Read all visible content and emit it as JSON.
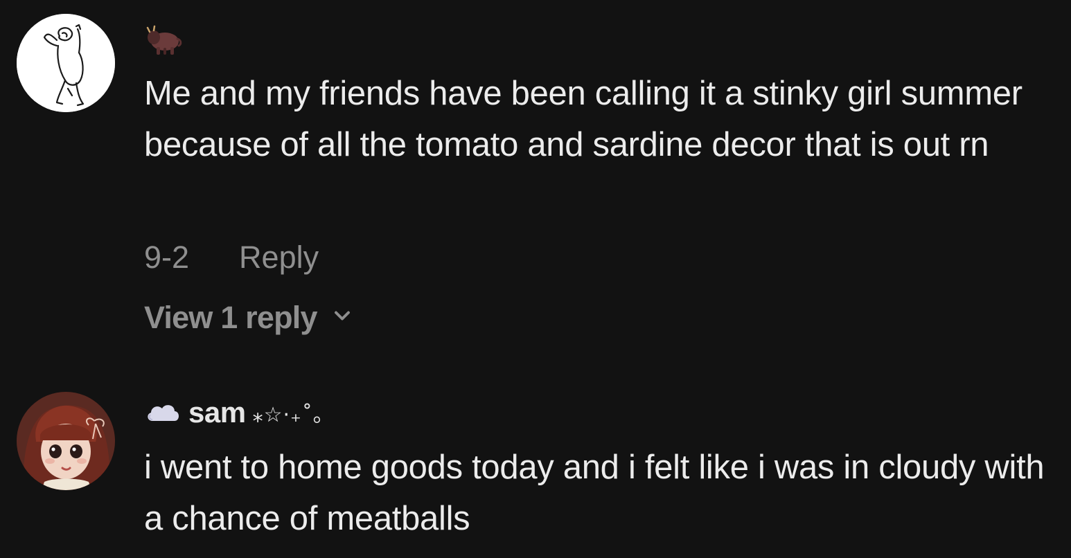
{
  "comments": [
    {
      "username": "",
      "badge_icon": "bison-icon",
      "text": "Me and my friends have been calling it a stinky girl summer because of all the tomato and sardine decor that is out rn",
      "date": "9-2",
      "reply_label": "Reply",
      "view_replies_label": "View 1 reply"
    },
    {
      "username": "sam",
      "badge_icon": "cloud-icon",
      "name_decoration": "⁎☆·₊˚｡",
      "text": "i went to home goods today and i felt like i was in cloudy with a chance of meatballs"
    }
  ],
  "colors": {
    "background": "#121212",
    "text": "#ececec",
    "muted": "#8f8f8f"
  }
}
